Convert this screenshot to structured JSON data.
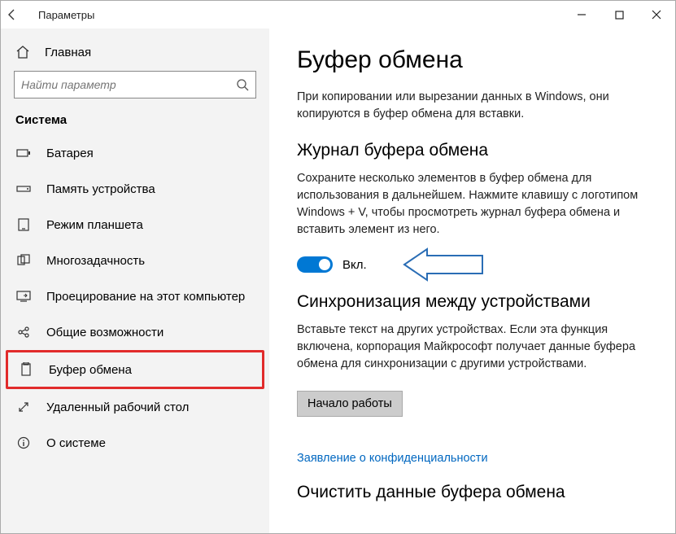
{
  "titlebar": {
    "title": "Параметры"
  },
  "sidebar": {
    "home": "Главная",
    "search_placeholder": "Найти параметр",
    "section": "Система",
    "items": [
      {
        "label": "Батарея"
      },
      {
        "label": "Память устройства"
      },
      {
        "label": "Режим планшета"
      },
      {
        "label": "Многозадачность"
      },
      {
        "label": "Проецирование на этот компьютер"
      },
      {
        "label": "Общие возможности"
      },
      {
        "label": "Буфер обмена"
      },
      {
        "label": "Удаленный рабочий стол"
      },
      {
        "label": "О системе"
      }
    ]
  },
  "main": {
    "title": "Буфер обмена",
    "intro": "При копировании или вырезании данных в Windows, они копируются в буфер обмена для вставки.",
    "history": {
      "heading": "Журнал буфера обмена",
      "desc": "Сохраните несколько элементов в буфер обмена для использования в дальнейшем. Нажмите клавишу с логотипом Windows + V, чтобы просмотреть журнал буфера обмена и вставить элемент из него.",
      "toggle_label": "Вкл."
    },
    "sync": {
      "heading": "Синхронизация между устройствами",
      "desc": "Вставьте текст на других устройствах. Если эта функция включена, корпорация Майкрософт получает данные буфера обмена для синхронизации с другими устройствами.",
      "button": "Начало работы"
    },
    "privacy_link": "Заявление о конфиденциальности",
    "clear": {
      "heading": "Очистить данные буфера обмена"
    }
  }
}
